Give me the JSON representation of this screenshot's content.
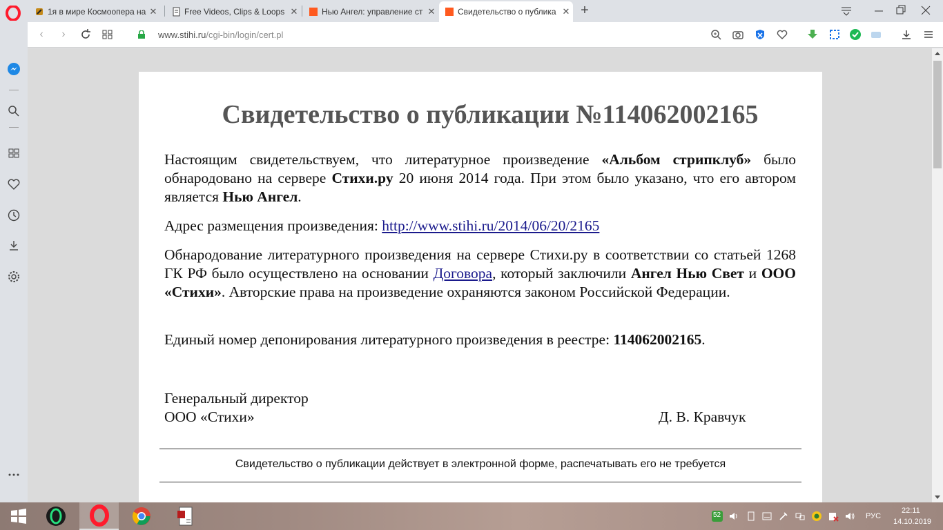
{
  "browser": {
    "tabs": [
      {
        "title": "1я в мире Космоопера на",
        "active": false
      },
      {
        "title": "Free Videos, Clips & Loops",
        "active": false
      },
      {
        "title": "Нью Ангел: управление ст",
        "active": false
      },
      {
        "title": "Свидетельство о публика",
        "active": true
      }
    ],
    "address": {
      "host": "www.stihi.ru",
      "path": "/cgi-bin/login/cert.pl"
    }
  },
  "certificate": {
    "title": "Свидетельство о публикации №114062002165",
    "p1": {
      "t1": "Настоящим свидетельствуем, что литературное произведение ",
      "work": "«Альбом стрипклуб»",
      "t2": " было обнародовано на сервере ",
      "site": "Стихи.ру",
      "t3": " 20 июня 2014 года. При этом было указано, что его автором является ",
      "author": "Нью Ангел",
      "t4": "."
    },
    "p2": {
      "label": "Адрес размещения произведения: ",
      "link": "http://www.stihi.ru/2014/06/20/2165"
    },
    "p3": {
      "t1": "Обнародование литературного произведения на сервере Стихи.ру в соответствии со статьей 1268 ГК РФ было осуществлено на основании ",
      "contract": "Договора",
      "t2": ", который заключили ",
      "party1": "Ангел Нью Свет",
      "t3": " и ",
      "party2": "ООО «Стихи»",
      "t4": ". Авторские права на произведение охраняются законом Российской Федерации."
    },
    "p4": {
      "label": "Единый номер депонирования литературного произведения в реестре: ",
      "number": "114062002165",
      "end": "."
    },
    "signature": {
      "position": "Генеральный директор",
      "company": "ООО «Стихи»",
      "name": "Д. В. Кравчук"
    },
    "footnote": "Свидетельство о публикации действует в электронной форме, распечатывать его не требуется"
  },
  "taskbar": {
    "badge": "52",
    "lang": "РУС",
    "time": "22:11",
    "date": "14.10.2019"
  },
  "colors": {
    "opera_red": "#ff1b2d",
    "link": "#1a1a8c",
    "title_gray": "#555555"
  }
}
